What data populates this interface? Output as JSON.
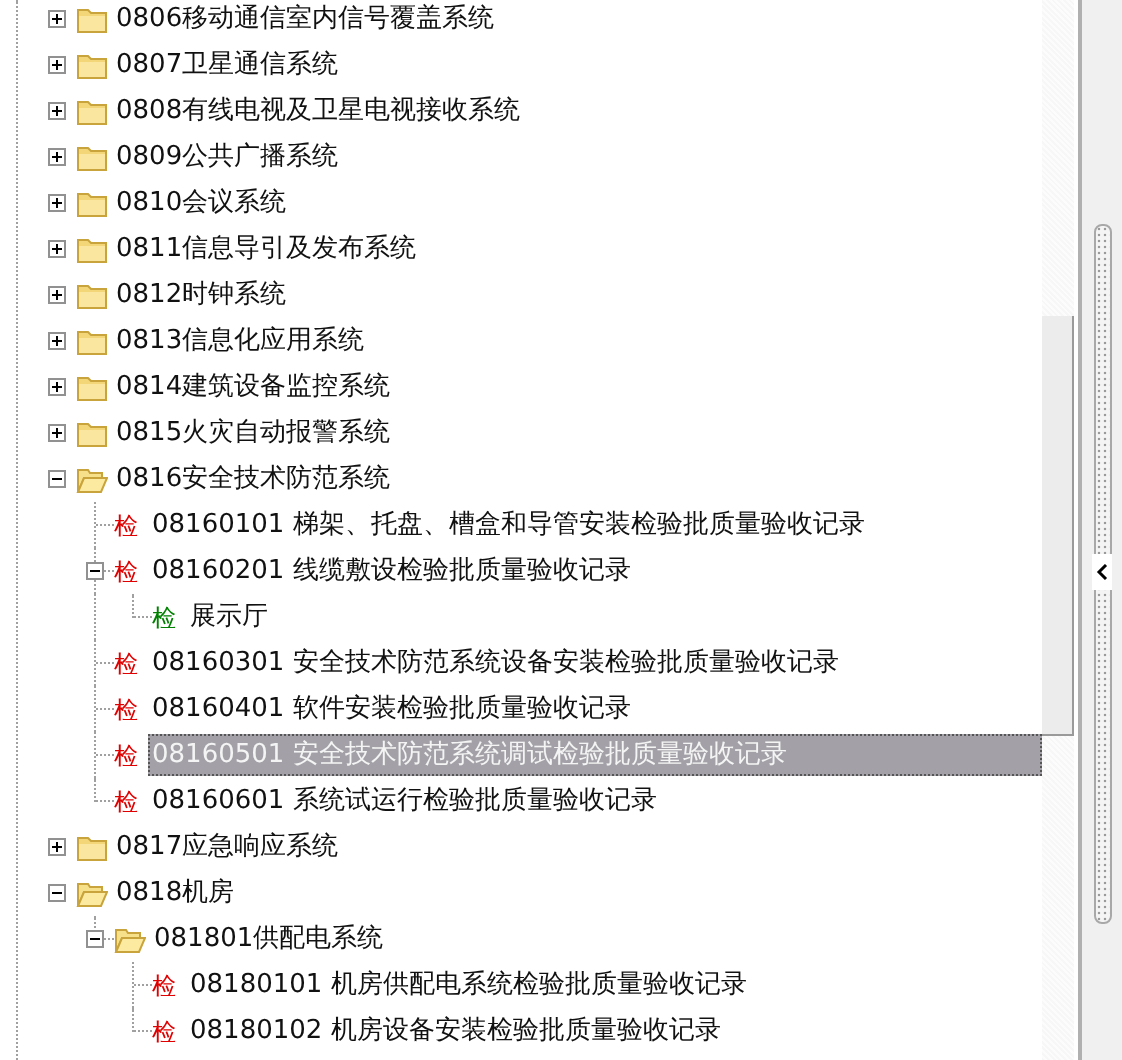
{
  "tree": [
    {
      "kind": "folder",
      "label": "0806移动通信室内信号覆盖系统",
      "expanded": false,
      "selected": false
    },
    {
      "kind": "folder",
      "label": "0807卫星通信系统",
      "expanded": false,
      "selected": false
    },
    {
      "kind": "folder",
      "label": "0808有线电视及卫星电视接收系统",
      "expanded": false,
      "selected": false
    },
    {
      "kind": "folder",
      "label": "0809公共广播系统",
      "expanded": false,
      "selected": false
    },
    {
      "kind": "folder",
      "label": "0810会议系统",
      "expanded": false,
      "selected": false
    },
    {
      "kind": "folder",
      "label": "0811信息导引及发布系统",
      "expanded": false,
      "selected": false
    },
    {
      "kind": "folder",
      "label": "0812时钟系统",
      "expanded": false,
      "selected": false
    },
    {
      "kind": "folder",
      "label": "0813信息化应用系统",
      "expanded": false,
      "selected": false
    },
    {
      "kind": "folder",
      "label": "0814建筑设备监控系统",
      "expanded": false,
      "selected": false
    },
    {
      "kind": "folder",
      "label": "0815火灾自动报警系统",
      "expanded": false,
      "selected": false
    },
    {
      "kind": "folder",
      "label": "0816安全技术防范系统",
      "expanded": true,
      "selected": false,
      "children": [
        {
          "kind": "record",
          "badge": "检",
          "color": "#e00000",
          "label": "08160101 梯架、托盘、槽盒和导管安装检验批质量验收记录",
          "selected": false
        },
        {
          "kind": "record",
          "badge": "检",
          "color": "#e00000",
          "label": "08160201 线缆敷设检验批质量验收记录",
          "expanded": true,
          "selected": false,
          "children": [
            {
              "kind": "record",
              "badge": "检",
              "color": "#008000",
              "label": "展示厅",
              "selected": false
            }
          ]
        },
        {
          "kind": "record",
          "badge": "检",
          "color": "#e00000",
          "label": "08160301 安全技术防范系统设备安装检验批质量验收记录",
          "selected": false
        },
        {
          "kind": "record",
          "badge": "检",
          "color": "#e00000",
          "label": "08160401 软件安装检验批质量验收记录",
          "selected": false
        },
        {
          "kind": "record",
          "badge": "检",
          "color": "#e00000",
          "label": "08160501 安全技术防范系统调试检验批质量验收记录",
          "selected": true
        },
        {
          "kind": "record",
          "badge": "检",
          "color": "#e00000",
          "label": "08160601 系统试运行检验批质量验收记录",
          "selected": false
        }
      ]
    },
    {
      "kind": "folder",
      "label": "0817应急响应系统",
      "expanded": false,
      "selected": false
    },
    {
      "kind": "folder",
      "label": "0818机房",
      "expanded": true,
      "selected": false,
      "children": [
        {
          "kind": "folder",
          "label": "081801供配电系统",
          "expanded": true,
          "selected": false,
          "children": [
            {
              "kind": "record",
              "badge": "检",
              "color": "#e00000",
              "label": "08180101 机房供配电系统检验批质量验收记录",
              "selected": false
            },
            {
              "kind": "record",
              "badge": "检",
              "color": "#e00000",
              "label": "08180102 机房设备安装检验批质量验收记录",
              "selected": false
            }
          ]
        }
      ]
    }
  ]
}
